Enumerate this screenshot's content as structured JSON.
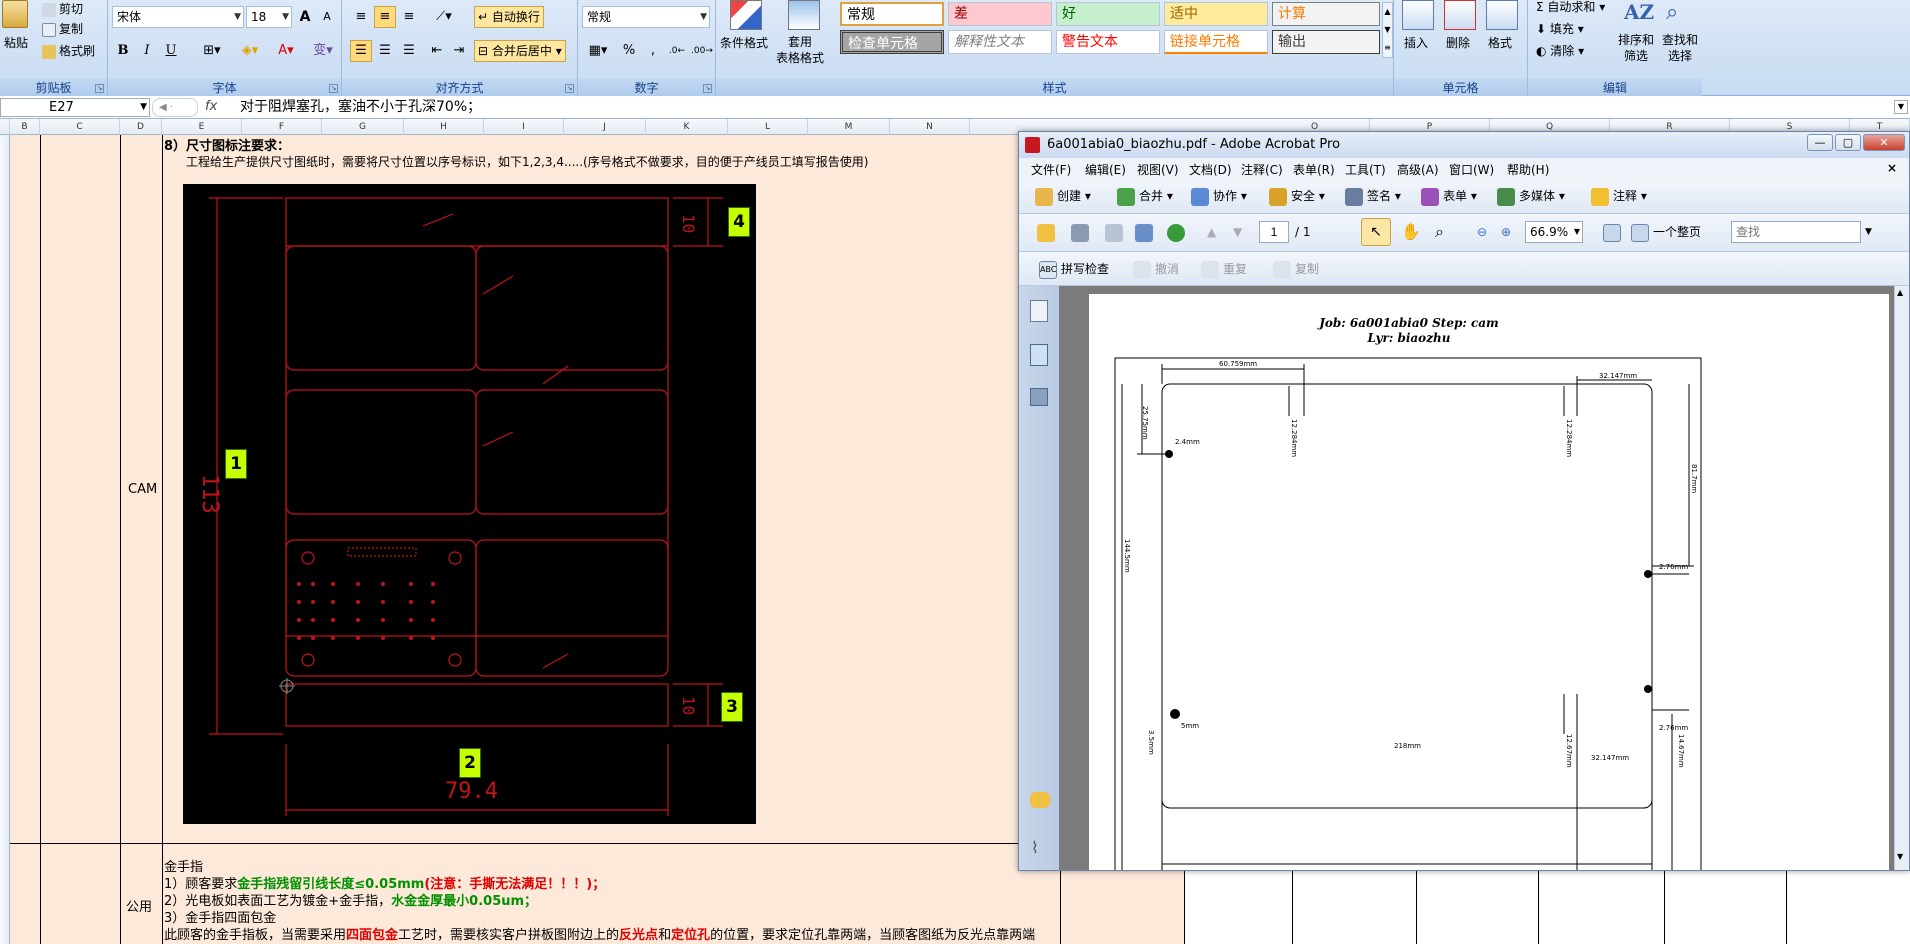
{
  "ribbon": {
    "clipboard": {
      "paste": "粘贴",
      "cut": "剪切",
      "copy": "复制",
      "format_painter": "格式刷",
      "title": "剪贴板"
    },
    "font": {
      "name": "宋体",
      "size": "18",
      "grow": "A",
      "shrink": "A",
      "bold": "B",
      "italic": "I",
      "underline": "U",
      "title": "字体"
    },
    "alignment": {
      "wrap": "自动换行",
      "merge": "合并后居中",
      "title": "对齐方式"
    },
    "number": {
      "format": "常规",
      "percent": "%",
      "comma": ",",
      "title": "数字"
    },
    "styles": {
      "cond_format": "条件格式",
      "table_format": "套用\n表格格式",
      "boxes": [
        "常规",
        "差",
        "好",
        "适中",
        "计算",
        "检查单元格",
        "解释性文本",
        "警告文本",
        "链接单元格",
        "输出"
      ],
      "title": "样式"
    },
    "cells": {
      "insert": "插入",
      "delete": "删除",
      "format": "格式",
      "title": "单元格"
    },
    "editing": {
      "autosum": "自动求和",
      "fill": "填充",
      "clear": "清除",
      "sort": "排序和\n筛选",
      "find": "查找和\n选择",
      "title": "编辑"
    }
  },
  "formula_bar": {
    "cell": "E27",
    "fx": "fx",
    "value": "对于阻焊塞孔，塞油不小于孔深70%；"
  },
  "columns": [
    "B",
    "C",
    "D",
    "E",
    "F",
    "G",
    "H",
    "I",
    "J",
    "K",
    "L",
    "M",
    "N",
    "O",
    "P",
    "Q",
    "R",
    "S",
    "T"
  ],
  "sheet": {
    "cam_label": "CAM",
    "heading": "8）尺寸图标注要求：",
    "desc": "工程给生产提供尺寸图纸时，需要将尺寸位置以序号标识，如下1,2,3,4.....(序号格式不做要求，目的便于产线员工填写报告使用)",
    "cad": {
      "dim_vertical": "113",
      "dim_bottom": "79.4",
      "dim_right": "10",
      "dim_right2": "10",
      "labels": [
        "1",
        "2",
        "3",
        "4"
      ]
    },
    "public_label": "公用",
    "gold_title": "金手指",
    "gold_line1_a": "1）顾客要求",
    "gold_line1_b": "金手指残留引线长度≤0.05mm",
    "gold_line1_c": "(注意：手撕无法满足！！！)；",
    "gold_line2_a": "2）光电板如表面工艺为镀金+金手指，",
    "gold_line2_b": "水金金厚最小0.05um；",
    "gold_line3": "3）金手指四面包金",
    "gold_line4_a": "此顾客的金手指板，当需要采用",
    "gold_line4_b": "四面包金",
    "gold_line4_c": "工艺时，需要核实客户拼板图附边上的",
    "gold_line4_d": "反光点",
    "gold_line4_e": "和",
    "gold_line4_f": "定位孔",
    "gold_line4_g": "的位置，要求定位孔靠两端，当顾客图纸为反光点靠两端"
  },
  "acrobat": {
    "title": "6a001abia0_biaozhu.pdf - Adobe Acrobat Pro",
    "menu": [
      "文件(F)",
      "编辑(E)",
      "视图(V)",
      "文档(D)",
      "注释(C)",
      "表单(R)",
      "工具(T)",
      "高级(A)",
      "窗口(W)",
      "帮助(H)"
    ],
    "tb1": [
      "创建",
      "合并",
      "协作",
      "安全",
      "签名",
      "表单",
      "多媒体",
      "注释"
    ],
    "page_current": "1",
    "page_total": "/ 1",
    "zoom": "66.9%",
    "view_mode": "一个整页",
    "search_placeholder": "查找",
    "tb3": [
      "拼写检查",
      "撤消",
      "重复",
      "复制"
    ],
    "pdf": {
      "job": "Job: 6a001abia0  Step: cam",
      "lyr": "Lyr: biaozhu",
      "dims": [
        "60.759mm",
        "32.147mm",
        "25.75mm",
        "2.4mm",
        "12.284mm",
        "12.284mm",
        "81.7mm",
        "144.5mm",
        "2.76mm",
        "2.76mm",
        "5mm",
        "218mm",
        "32.147mm",
        "14.67mm",
        "12.67mm",
        "3.5mm"
      ]
    }
  }
}
